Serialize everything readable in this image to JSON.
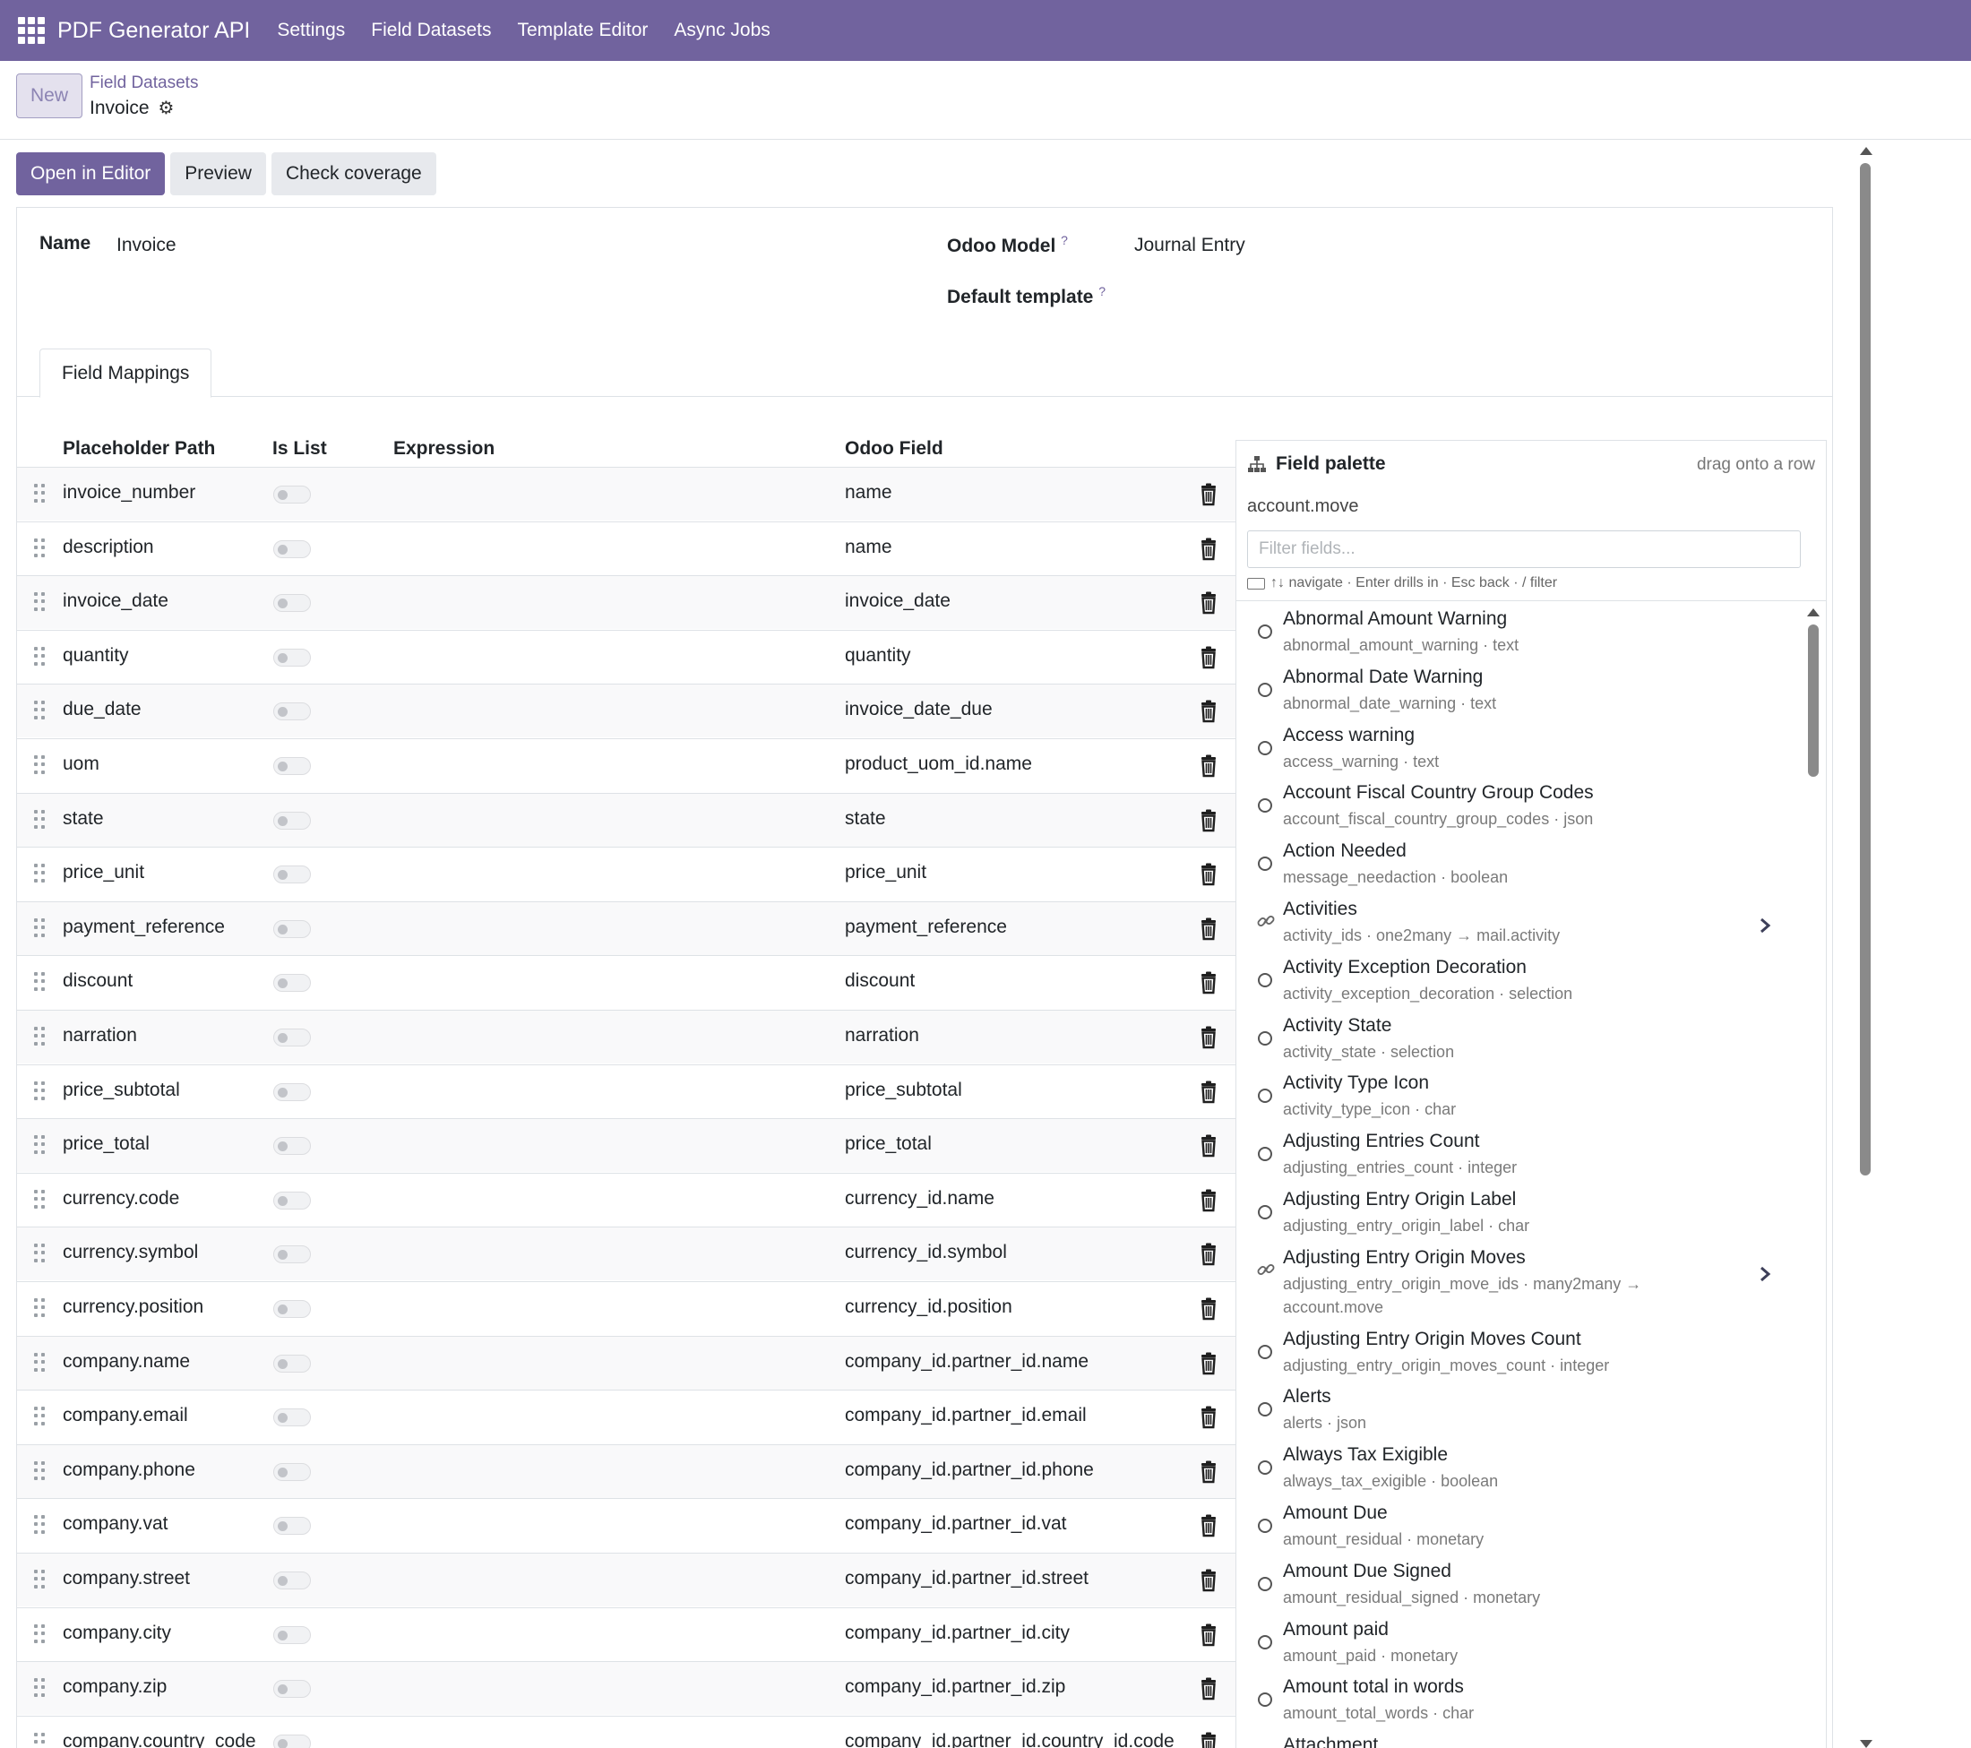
{
  "navbar": {
    "brand": "PDF Generator API",
    "items": [
      "Settings",
      "Field Datasets",
      "Template Editor",
      "Async Jobs"
    ]
  },
  "control": {
    "new_label": "New",
    "breadcrumb_parent": "Field Datasets",
    "breadcrumb_current": "Invoice"
  },
  "actions": {
    "open_editor": "Open in Editor",
    "preview": "Preview",
    "check_coverage": "Check coverage"
  },
  "form": {
    "name_label": "Name",
    "name_value": "Invoice",
    "model_label": "Odoo Model",
    "model_value": "Journal Entry",
    "default_template_label": "Default template",
    "help_mark": "?"
  },
  "tabs": [
    "Field Mappings"
  ],
  "table": {
    "headers": [
      "Placeholder Path",
      "Is List",
      "Expression",
      "Odoo Field"
    ],
    "rows": [
      {
        "path": "invoice_number",
        "odoo_field": "name"
      },
      {
        "path": "description",
        "odoo_field": "name"
      },
      {
        "path": "invoice_date",
        "odoo_field": "invoice_date"
      },
      {
        "path": "quantity",
        "odoo_field": "quantity"
      },
      {
        "path": "due_date",
        "odoo_field": "invoice_date_due"
      },
      {
        "path": "uom",
        "odoo_field": "product_uom_id.name"
      },
      {
        "path": "state",
        "odoo_field": "state"
      },
      {
        "path": "price_unit",
        "odoo_field": "price_unit"
      },
      {
        "path": "payment_reference",
        "odoo_field": "payment_reference"
      },
      {
        "path": "discount",
        "odoo_field": "discount"
      },
      {
        "path": "narration",
        "odoo_field": "narration"
      },
      {
        "path": "price_subtotal",
        "odoo_field": "price_subtotal"
      },
      {
        "path": "price_total",
        "odoo_field": "price_total"
      },
      {
        "path": "currency.code",
        "odoo_field": "currency_id.name"
      },
      {
        "path": "currency.symbol",
        "odoo_field": "currency_id.symbol"
      },
      {
        "path": "currency.position",
        "odoo_field": "currency_id.position"
      },
      {
        "path": "company.name",
        "odoo_field": "company_id.partner_id.name"
      },
      {
        "path": "company.email",
        "odoo_field": "company_id.partner_id.email"
      },
      {
        "path": "company.phone",
        "odoo_field": "company_id.partner_id.phone"
      },
      {
        "path": "company.vat",
        "odoo_field": "company_id.partner_id.vat"
      },
      {
        "path": "company.street",
        "odoo_field": "company_id.partner_id.street"
      },
      {
        "path": "company.city",
        "odoo_field": "company_id.partner_id.city"
      },
      {
        "path": "company.zip",
        "odoo_field": "company_id.partner_id.zip"
      },
      {
        "path": "company.country_code",
        "odoo_field": "company_id.partner_id.country_id.code"
      }
    ]
  },
  "palette": {
    "title": "Field palette",
    "hint": "drag onto a row",
    "model": "account.move",
    "filter_placeholder": "Filter fields...",
    "keys_hint": "↑↓ navigate · Enter drills in · Esc back · / filter",
    "fields": [
      {
        "name": "Abnormal Amount Warning",
        "meta": "abnormal_amount_warning · text",
        "relational": false
      },
      {
        "name": "Abnormal Date Warning",
        "meta": "abnormal_date_warning · text",
        "relational": false
      },
      {
        "name": "Access warning",
        "meta": "access_warning · text",
        "relational": false
      },
      {
        "name": "Account Fiscal Country Group Codes",
        "meta": "account_fiscal_country_group_codes · json",
        "relational": false
      },
      {
        "name": "Action Needed",
        "meta": "message_needaction · boolean",
        "relational": false
      },
      {
        "name": "Activities",
        "meta": "activity_ids · one2many → mail.activity",
        "relational": true
      },
      {
        "name": "Activity Exception Decoration",
        "meta": "activity_exception_decoration · selection",
        "relational": false
      },
      {
        "name": "Activity State",
        "meta": "activity_state · selection",
        "relational": false
      },
      {
        "name": "Activity Type Icon",
        "meta": "activity_type_icon · char",
        "relational": false
      },
      {
        "name": "Adjusting Entries Count",
        "meta": "adjusting_entries_count · integer",
        "relational": false
      },
      {
        "name": "Adjusting Entry Origin Label",
        "meta": "adjusting_entry_origin_label · char",
        "relational": false
      },
      {
        "name": "Adjusting Entry Origin Moves",
        "meta": "adjusting_entry_origin_move_ids · many2many → account.move",
        "relational": true
      },
      {
        "name": "Adjusting Entry Origin Moves Count",
        "meta": "adjusting_entry_origin_moves_count · integer",
        "relational": false
      },
      {
        "name": "Alerts",
        "meta": "alerts · json",
        "relational": false
      },
      {
        "name": "Always Tax Exigible",
        "meta": "always_tax_exigible · boolean",
        "relational": false
      },
      {
        "name": "Amount Due",
        "meta": "amount_residual · monetary",
        "relational": false
      },
      {
        "name": "Amount Due Signed",
        "meta": "amount_residual_signed · monetary",
        "relational": false
      },
      {
        "name": "Amount paid",
        "meta": "amount_paid · monetary",
        "relational": false
      },
      {
        "name": "Amount total in words",
        "meta": "amount_total_words · char",
        "relational": false
      },
      {
        "name": "Attachment",
        "meta": "",
        "relational": true
      }
    ]
  },
  "colors": {
    "brand": "#71639e",
    "border": "#dee2e6"
  }
}
